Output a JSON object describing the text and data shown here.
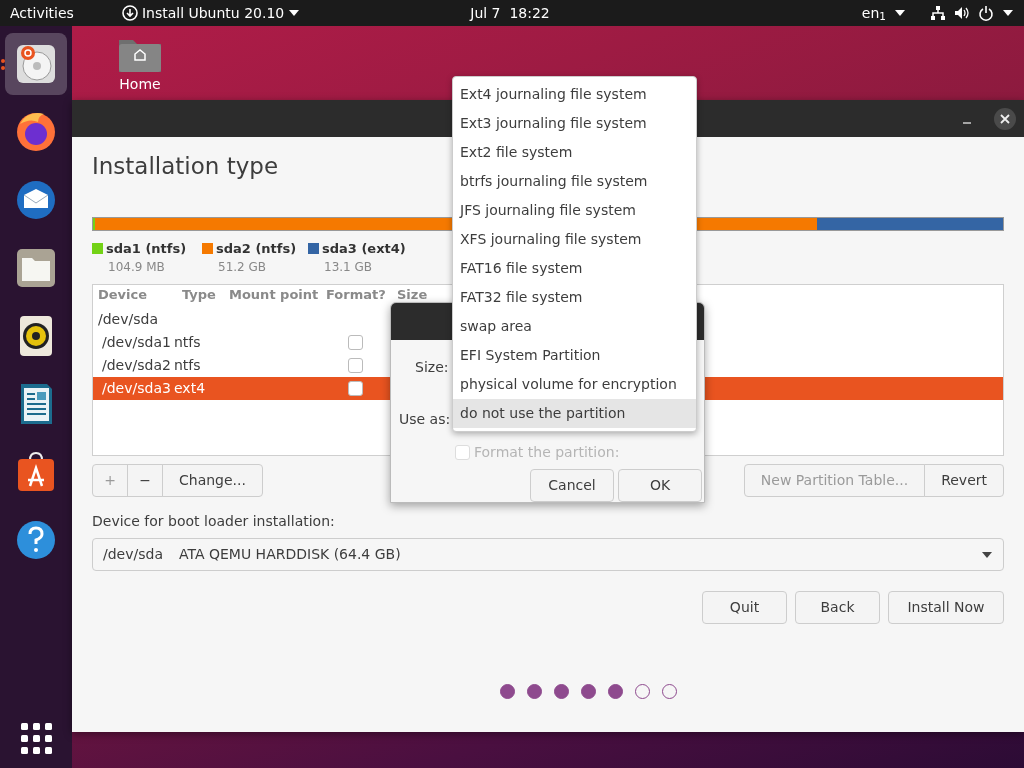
{
  "top_bar": {
    "activities": "Activities",
    "app_menu": "Install Ubuntu 20.10",
    "clock": "Jul 7  18:22",
    "keyboard": "en$_{1}$"
  },
  "dock": {
    "items": [
      {
        "kind": "installer",
        "selected": true
      },
      {
        "kind": "browser",
        "selected": false
      },
      {
        "kind": "mail",
        "selected": false
      },
      {
        "kind": "files",
        "selected": false
      },
      {
        "kind": "music",
        "selected": false
      },
      {
        "kind": "writer",
        "selected": false
      },
      {
        "kind": "store",
        "selected": false
      },
      {
        "kind": "help",
        "selected": false
      }
    ]
  },
  "desktop_icons": [
    {
      "label": "Home"
    }
  ],
  "window": {
    "title": "Installation type",
    "partition_bar": [
      {
        "label": "sda1 (ntfs)",
        "size": "104.9 MB",
        "color": "#73d216",
        "level": 0.002
      },
      {
        "label": "sda2 (ntfs)",
        "size": "51.2 GB",
        "color": "#f57900",
        "level": 0.794
      },
      {
        "label": "sda3 (ext4)",
        "size": "13.1 GB",
        "color": "#3465a4",
        "level": 0.204
      }
    ],
    "table": {
      "columns": [
        "Device",
        "Type",
        "Mount point",
        "Format?",
        "Size"
      ],
      "rows": [
        {
          "kind": "disk",
          "device": "/dev/sda",
          "selected": false
        },
        {
          "kind": "partition",
          "device": "/dev/sda1",
          "type": "ntfs",
          "format": false,
          "selected": false
        },
        {
          "kind": "partition",
          "device": "/dev/sda2",
          "type": "ntfs",
          "format": false,
          "selected": false
        },
        {
          "kind": "partition",
          "device": "/dev/sda3",
          "type": "ext4",
          "format": false,
          "selected": true
        }
      ]
    },
    "table_buttons": [
      {
        "label": "+",
        "disabled": true
      },
      {
        "label": "−",
        "disabled": false
      },
      {
        "label": "Change...",
        "disabled": false
      }
    ],
    "right_buttons": [
      {
        "label": "New Partition Table...",
        "disabled": true
      },
      {
        "label": "Revert",
        "disabled": false
      }
    ],
    "boot_loader": {
      "label": "Device for boot loader installation:",
      "device": "/dev/sda",
      "description": "ATA QEMU HARDDISK (64.4 GB)"
    },
    "nav_buttons": [
      "Quit",
      "Back",
      "Install Now"
    ],
    "progress_dots": [
      {
        "done": true
      },
      {
        "done": true
      },
      {
        "done": true
      },
      {
        "done": true
      },
      {
        "done": true
      },
      {
        "done": false
      },
      {
        "done": false
      }
    ]
  },
  "dialog": {
    "size_label": "Size:",
    "use_as_label": "Use as:",
    "format_checkbox": {
      "label": "Format the partition:",
      "checked": false,
      "disabled": true
    },
    "buttons": [
      "Cancel",
      "OK"
    ]
  },
  "use_as_menu": {
    "items": [
      {
        "label": "Ext4 journaling file system",
        "selected": false
      },
      {
        "label": "Ext3 journaling file system",
        "selected": false
      },
      {
        "label": "Ext2 file system",
        "selected": false
      },
      {
        "label": "btrfs journaling file system",
        "selected": false
      },
      {
        "label": "JFS journaling file system",
        "selected": false
      },
      {
        "label": "XFS journaling file system",
        "selected": false
      },
      {
        "label": "FAT16 file system",
        "selected": false
      },
      {
        "label": "FAT32 file system",
        "selected": false
      },
      {
        "label": "swap area",
        "selected": false
      },
      {
        "label": "EFI System Partition",
        "selected": false
      },
      {
        "label": "physical volume for encryption",
        "selected": false
      },
      {
        "label": "do not use the partition",
        "selected": true
      }
    ]
  }
}
